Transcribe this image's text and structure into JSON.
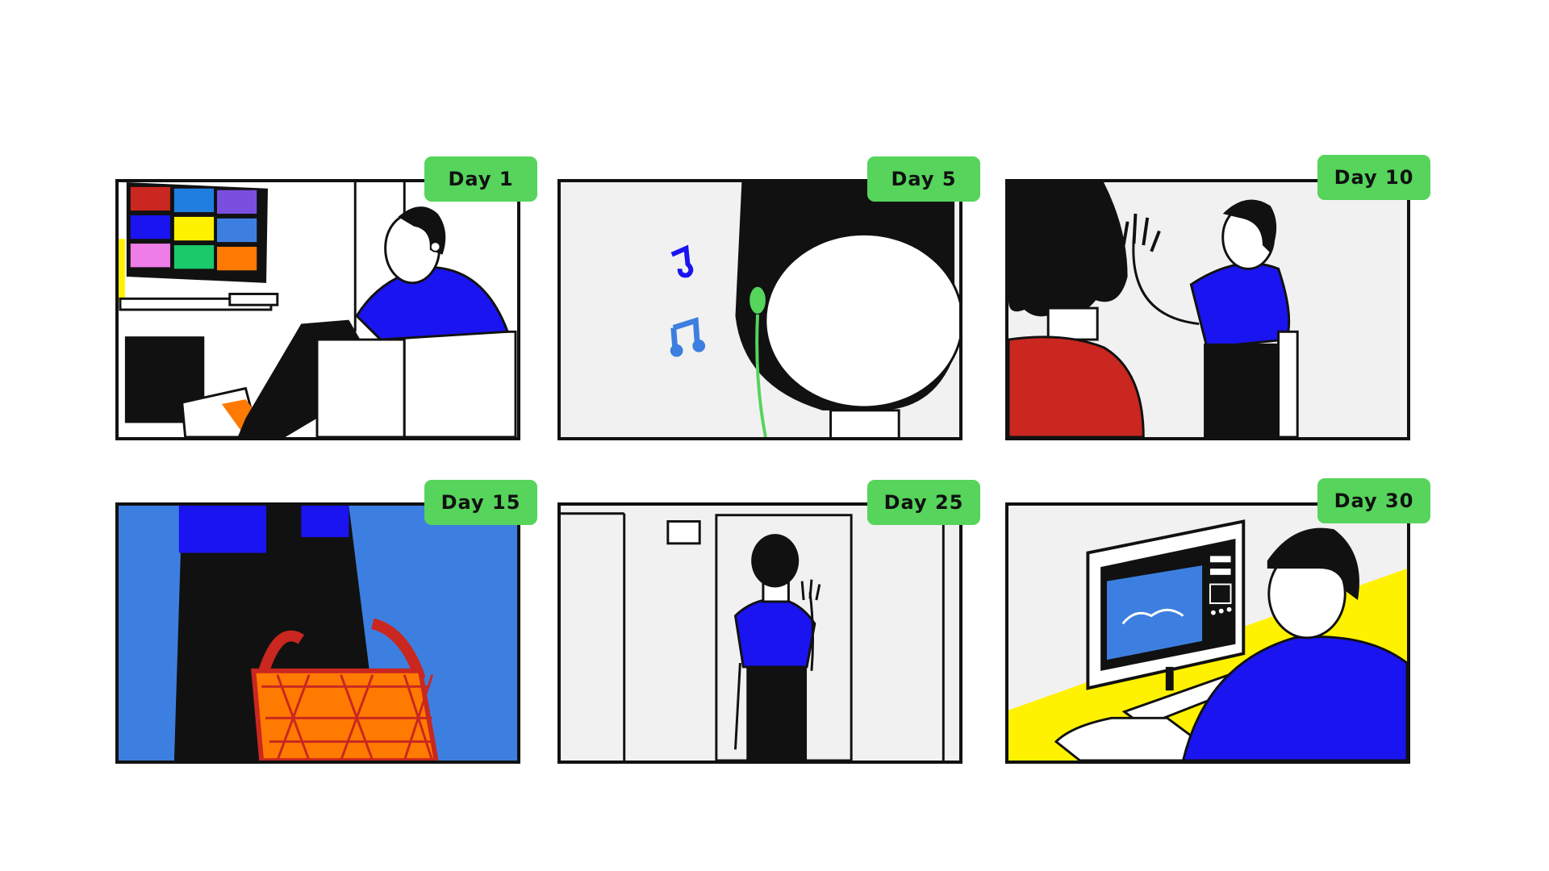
{
  "panels": [
    {
      "label": "Day 1"
    },
    {
      "label": "Day 5"
    },
    {
      "label": "Day 10"
    },
    {
      "label": "Day 15"
    },
    {
      "label": "Day 25"
    },
    {
      "label": "Day 30"
    }
  ],
  "colors": {
    "tag_green": "#56d45b",
    "shirt_blue": "#1a14f0",
    "background_blue": "#3d7fe0",
    "accent_red": "#c9271f",
    "accent_orange": "#ff7a00",
    "accent_yellow": "#fff200",
    "outline": "#111111",
    "wall_grey": "#f1f1f1"
  }
}
